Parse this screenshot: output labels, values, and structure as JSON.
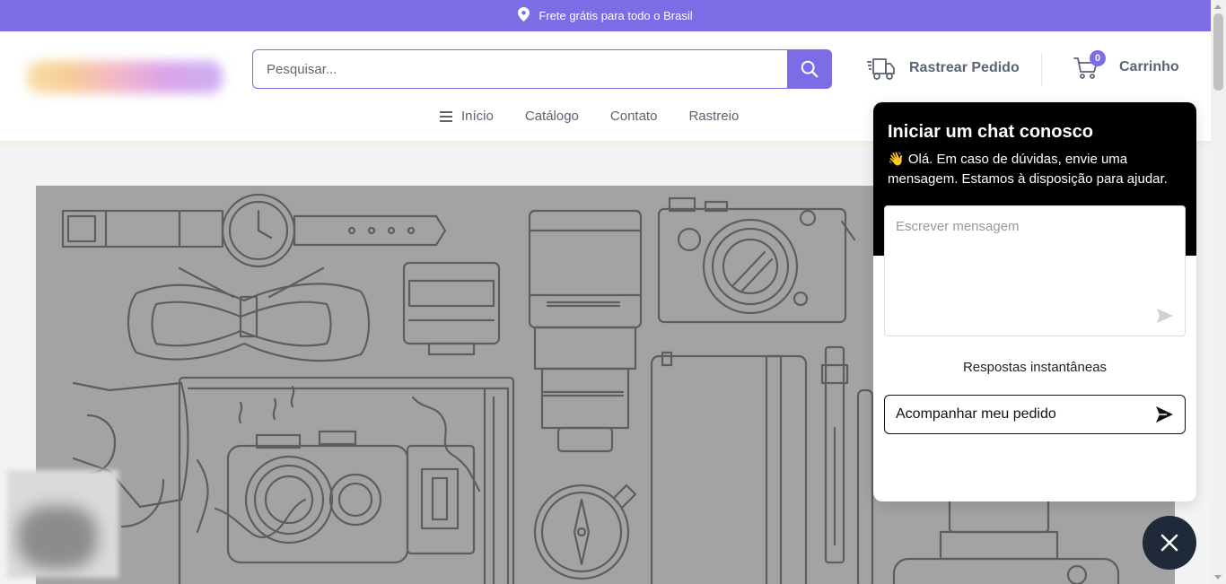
{
  "topbar": {
    "text": "Frete grátis para todo o Brasil",
    "icon": "location-pin-icon"
  },
  "search": {
    "placeholder": "Pesquisar...",
    "icon": "search-icon"
  },
  "header": {
    "track_label": "Rastrear Pedido",
    "cart_label": "Carrinho",
    "cart_count": "0"
  },
  "nav": {
    "items": [
      {
        "label": "Início",
        "icon": "hamburger-icon"
      },
      {
        "label": "Catálogo"
      },
      {
        "label": "Contato"
      },
      {
        "label": "Rastreio"
      }
    ]
  },
  "chat": {
    "title": "Iniciar um chat conosco",
    "subtitle": "👋 Olá. Em caso de dúvidas, envie uma mensagem. Estamos à disposição para ajudar.",
    "input_placeholder": "Escrever mensagem",
    "quick_title": "Respostas instantâneas",
    "quick_reply": "Acompanhar meu pedido"
  },
  "colors": {
    "accent": "#7c6ce6",
    "chat_header": "#000000",
    "chat_close": "#1f2937",
    "hero_bg": "#a3a3a3"
  }
}
